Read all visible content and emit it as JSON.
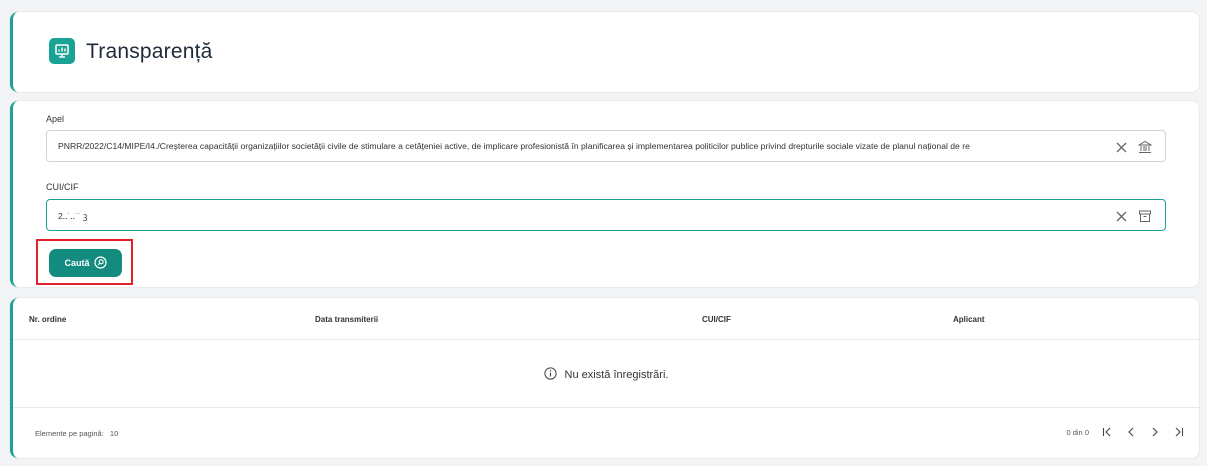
{
  "header": {
    "title": "Transparență",
    "logo_icon": "presentation-icon"
  },
  "form": {
    "apel_label": "Apel",
    "apel_value": "PNRR/2022/C14/MIPE/I4./Creșterea capacității organizațiilor societății civile de stimulare a cetățeniei active, de implicare profesionistă în planificarea și implementarea politicilor publice privind drepturile sociale vizate de planul național de re",
    "cui_label": "CUI/CIF",
    "cui_value": "2‥˙‥˙˙ ꝫ",
    "search_label": "Caută"
  },
  "table": {
    "columns": [
      "Nr. ordine",
      "Data transmiterii",
      "CUI/CIF",
      "Aplicant"
    ],
    "empty_message": "Nu există înregistrări.",
    "page_size_label": "Elemente pe pagină:",
    "page_size_value": "10",
    "range_text": "0 din 0"
  },
  "colors": {
    "accent": "#1aa394",
    "button": "#138b7e",
    "highlight": "#e0232a"
  }
}
